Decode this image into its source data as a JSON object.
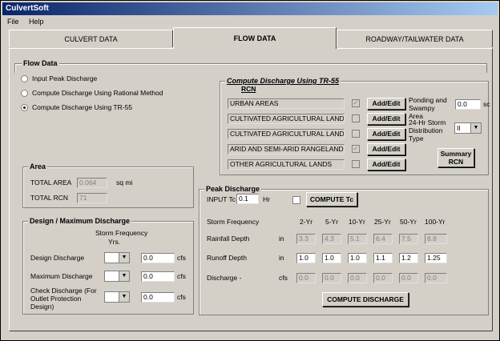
{
  "app": {
    "title": "CulvertSoft"
  },
  "menu": {
    "file": "File",
    "help": "Help"
  },
  "tabs": {
    "culvert": "CULVERT DATA",
    "flow": "FLOW DATA",
    "roadway": "ROADWAY/TAILWATER DATA"
  },
  "flow_data": {
    "title": "Flow Data",
    "options": [
      "Input Peak Discharge",
      "Compute Discharge Using Rational Method",
      "Compute Discharge Using TR-55"
    ]
  },
  "tr55": {
    "title": "Compute Discharge Using TR-55",
    "rcn_label": "RCN",
    "rows": [
      "URBAN AREAS",
      "CULTIVATED AGRICULTURAL LANDS-(A)",
      "CULTIVATED AGRICULTURAL LANDS-(B)",
      "ARID AND SEMI-ARID RANGELANDS",
      "OTHER AGRICULTURAL LANDS"
    ],
    "checks": [
      "✓",
      "",
      "",
      "✓",
      ""
    ],
    "add_edit": "Add/Edit",
    "ponding_label": "Ponding and Swampy Area",
    "ponding_value": "0.0",
    "ponding_unit": "sc",
    "storm_label": "24-Hr Storm Distribution Type",
    "storm_value": "II",
    "summary_label": "Summary RCN"
  },
  "area": {
    "title": "Area",
    "total_area_label": "TOTAL AREA",
    "total_area_value": "0.064",
    "total_area_unit": "sq mi",
    "total_rcn_label": "TOTAL RCN",
    "total_rcn_value": "71"
  },
  "design": {
    "title": "Design / Maximum Discharge",
    "storm_freq": "Storm Frequency",
    "yrs": "Yrs.",
    "rows": [
      {
        "label": "Design Discharge",
        "value": "0.0",
        "unit": "cfs"
      },
      {
        "label": "Maximum Discharge",
        "value": "0.0",
        "unit": "cfs"
      },
      {
        "label": "Check Discharge (For Outlet Protection Design)",
        "value": "0.0",
        "unit": "cfs"
      }
    ]
  },
  "peak": {
    "title": "Peak Discharge",
    "tc_label": "INPUT Tc",
    "tc_value": "0.1",
    "tc_unit": "Hr",
    "compute_tc": "COMPUTE Tc",
    "storm_freq_label": "Storm Frequency",
    "years": [
      "2-Yr",
      "5-Yr",
      "10-Yr",
      "25-Yr",
      "50-Yr",
      "100-Yr"
    ],
    "rainfall_label": "Rainfall Depth",
    "rainfall_unit": "in",
    "rainfall": [
      "3.3",
      "4.3",
      "5.1",
      "6.4",
      "7.5",
      "8.8"
    ],
    "runoff_label": "Runoff Depth",
    "runoff_unit": "in",
    "runoff": [
      "1.0",
      "1.0",
      "1.0",
      "1.1",
      "1.2",
      "1.25"
    ],
    "discharge_label": "Discharge -",
    "discharge_unit": "cfs",
    "discharge": [
      "0.0",
      "0.0",
      "0.0",
      "0.0",
      "0.0",
      "0.0"
    ],
    "compute_discharge": "COMPUTE DISCHARGE"
  }
}
